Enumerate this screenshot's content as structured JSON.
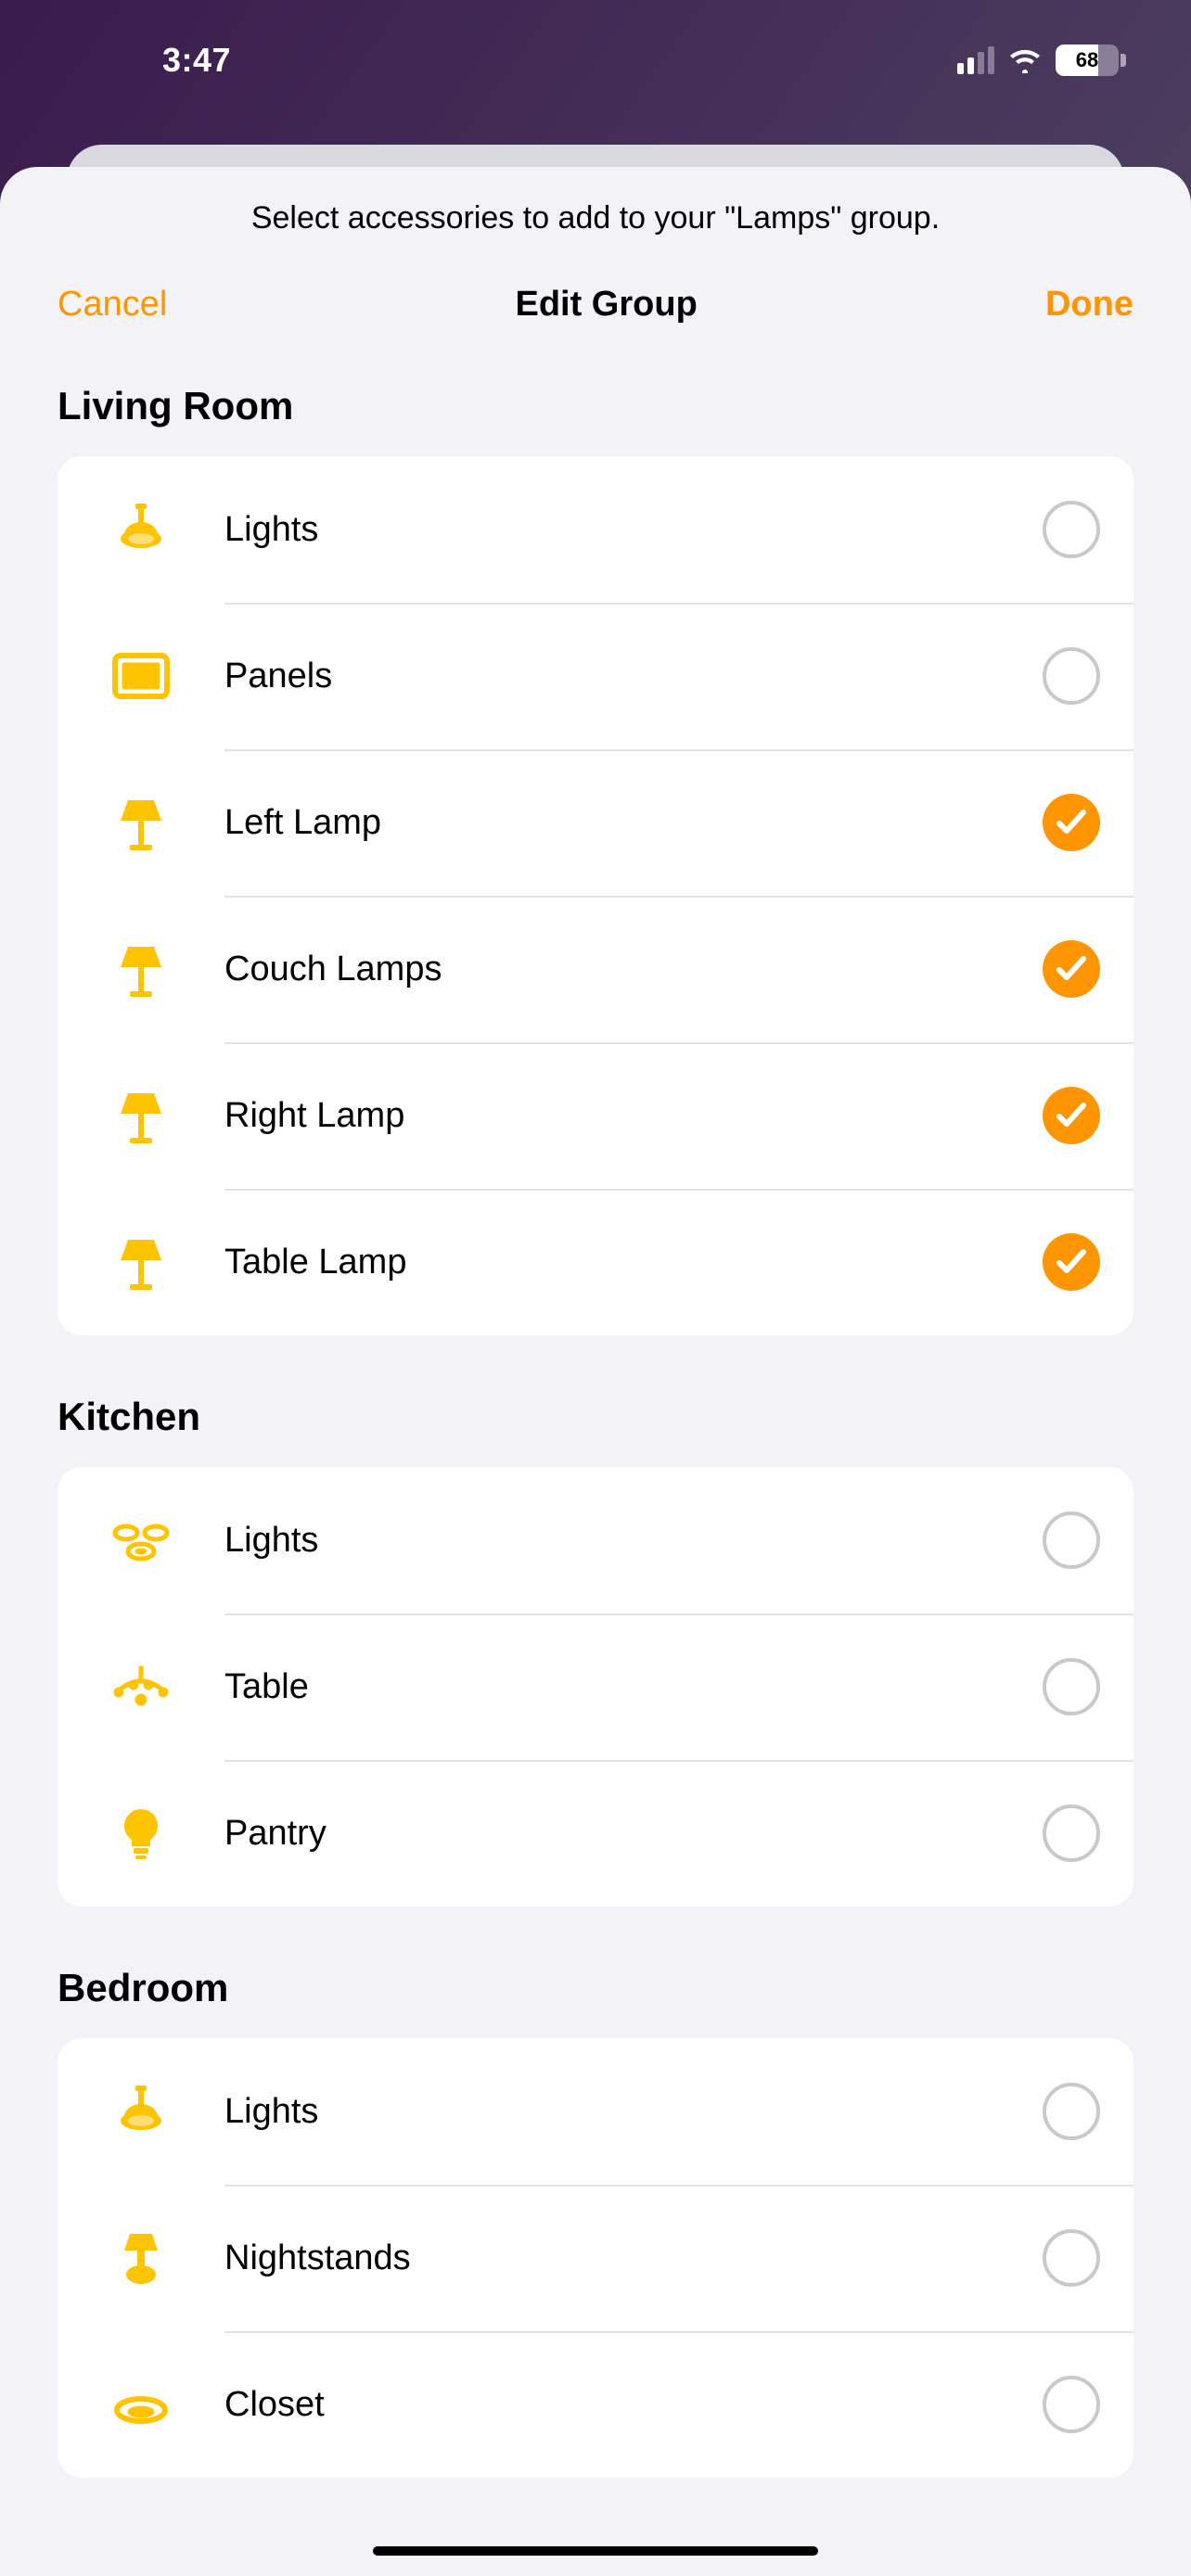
{
  "status": {
    "time": "3:47",
    "battery": "68"
  },
  "sheet": {
    "instruction": "Select accessories to add to your \"Lamps\" group.",
    "cancel": "Cancel",
    "title": "Edit Group",
    "done": "Done"
  },
  "colors": {
    "accent": "#ff9500",
    "iconYellow": "#ffc400"
  },
  "sections": [
    {
      "title": "Living Room",
      "items": [
        {
          "label": "Lights",
          "icon": "ceiling",
          "selected": false
        },
        {
          "label": "Panels",
          "icon": "panel",
          "selected": false
        },
        {
          "label": "Left Lamp",
          "icon": "lamp",
          "selected": true
        },
        {
          "label": "Couch Lamps",
          "icon": "lamp",
          "selected": true
        },
        {
          "label": "Right Lamp",
          "icon": "lamp",
          "selected": true
        },
        {
          "label": "Table Lamp",
          "icon": "lamp",
          "selected": true
        }
      ]
    },
    {
      "title": "Kitchen",
      "items": [
        {
          "label": "Lights",
          "icon": "spots",
          "selected": false
        },
        {
          "label": "Table",
          "icon": "chandelier",
          "selected": false
        },
        {
          "label": "Pantry",
          "icon": "bulb",
          "selected": false
        }
      ]
    },
    {
      "title": "Bedroom",
      "items": [
        {
          "label": "Lights",
          "icon": "ceiling",
          "selected": false
        },
        {
          "label": "Nightstands",
          "icon": "bedlamp",
          "selected": false
        },
        {
          "label": "Closet",
          "icon": "recessed",
          "selected": false
        }
      ]
    }
  ]
}
